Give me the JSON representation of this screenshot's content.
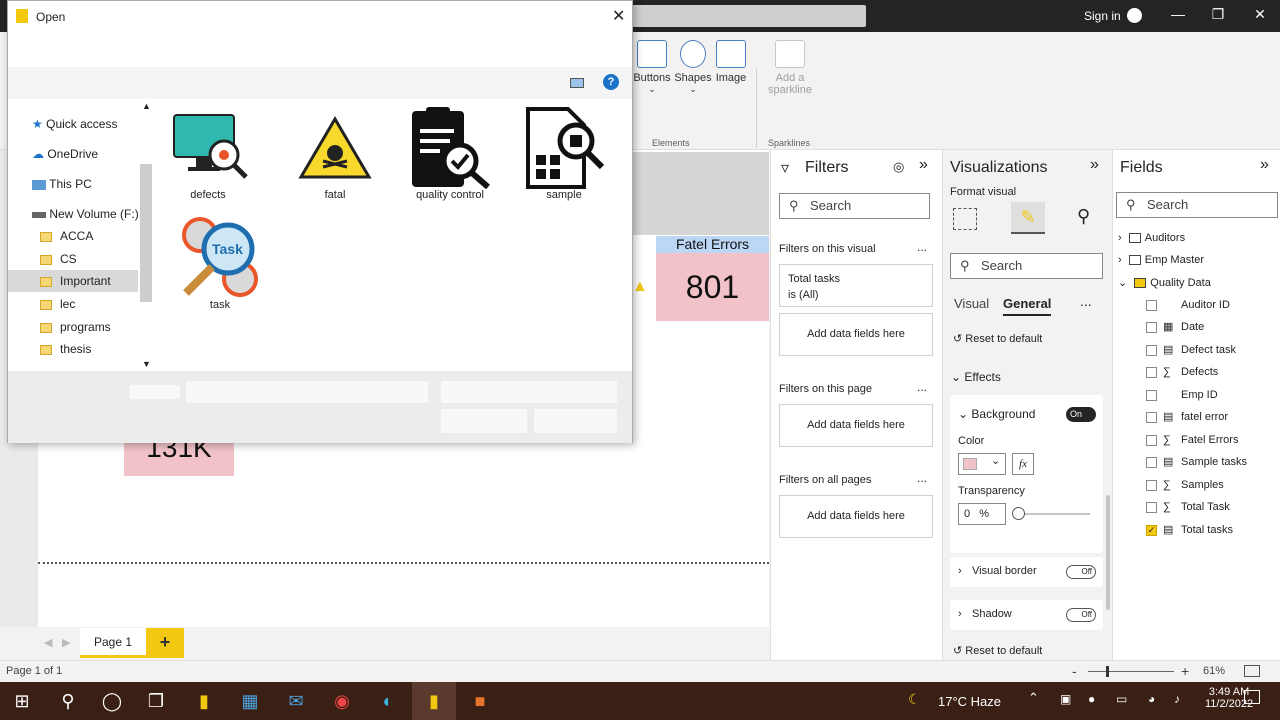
{
  "titlebar": {
    "signin": "Sign in"
  },
  "ribbon": {
    "buttons": [
      {
        "label": "Buttons"
      },
      {
        "label": "Shapes"
      },
      {
        "label": "Image"
      },
      {
        "label": "Add a sparkline"
      }
    ],
    "groups": {
      "elements": "Elements",
      "sparklines": "Sparklines"
    }
  },
  "canvas": {
    "card_header": "Fatel Errors",
    "card_value": "801",
    "card2_value": "131K"
  },
  "pages": {
    "tab": "Page 1",
    "add": "+"
  },
  "status": {
    "page": "Page 1 of 1",
    "zoom": "61%",
    "zoom_out": "-",
    "zoom_in": "+"
  },
  "filters": {
    "title": "Filters",
    "search": "Search",
    "on_visual": "Filters on this visual",
    "total_tasks": "Total tasks",
    "total_tasks_state": "is (All)",
    "add_fields": "Add data fields here",
    "on_page": "Filters on this page",
    "on_all": "Filters on all pages",
    "more": "..."
  },
  "viz": {
    "title": "Visualizations",
    "format": "Format visual",
    "search": "Search",
    "tab_visual": "Visual",
    "tab_general": "General",
    "more": "...",
    "reset": "Reset to default",
    "effects": "Effects",
    "background": "Background",
    "bg_toggle": "On",
    "color": "Color",
    "fx": "fx",
    "transparency": "Transparency",
    "trans_value": "0",
    "trans_unit": "%",
    "visual_border": "Visual border",
    "shadow": "Shadow",
    "off": "Off",
    "reset2": "Reset to default"
  },
  "fields": {
    "title": "Fields",
    "search": "Search",
    "tables": [
      {
        "name": "Auditors"
      },
      {
        "name": "Emp Master"
      },
      {
        "name": "Quality Data"
      }
    ],
    "items": [
      {
        "name": "Auditor ID",
        "sigma": ""
      },
      {
        "name": "Date",
        "sigma": ""
      },
      {
        "name": "Defect task",
        "sigma": ""
      },
      {
        "name": "Defects",
        "sigma": "∑"
      },
      {
        "name": "Emp ID",
        "sigma": ""
      },
      {
        "name": "fatel error",
        "sigma": ""
      },
      {
        "name": "Fatel Errors",
        "sigma": "∑"
      },
      {
        "name": "Sample tasks",
        "sigma": ""
      },
      {
        "name": "Samples",
        "sigma": "∑"
      },
      {
        "name": "Total Task",
        "sigma": "∑"
      },
      {
        "name": "Total tasks",
        "sigma": ""
      }
    ]
  },
  "dialog": {
    "title": "Open",
    "close": "✕",
    "nav": [
      {
        "label": "Quick access"
      },
      {
        "label": "OneDrive"
      },
      {
        "label": "This PC"
      },
      {
        "label": "New Volume (F:)"
      },
      {
        "label": "ACCA"
      },
      {
        "label": "CS"
      },
      {
        "label": "Important"
      },
      {
        "label": "lec"
      },
      {
        "label": "programs"
      },
      {
        "label": "thesis"
      }
    ],
    "files": [
      {
        "label": "defects"
      },
      {
        "label": "fatal"
      },
      {
        "label": "quality control"
      },
      {
        "label": "sample"
      },
      {
        "label": "task"
      }
    ],
    "task_icon_text": "Task"
  },
  "taskbar": {
    "weather": "17°C  Haze",
    "time": "3:49 AM",
    "date": "11/2/2022"
  },
  "colors": {
    "accent": "#f2c811",
    "card_pink": "#f1c3c8",
    "card_blue": "#bcd6f5",
    "taskbar": "#3a1f14"
  }
}
